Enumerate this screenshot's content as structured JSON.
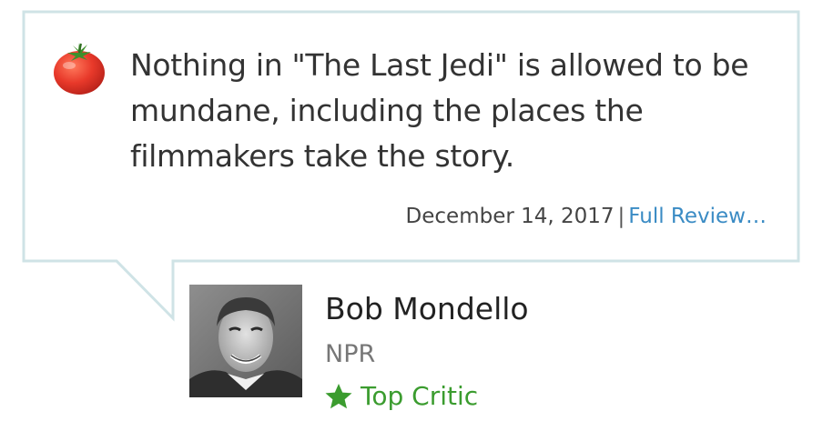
{
  "review": {
    "quote": "Nothing in \"The Last Jedi\" is allowed to be mundane, including the places the filmmakers take the story.",
    "date": "December 14, 2017",
    "separator": "|",
    "full_review_link": "Full Review…",
    "rating_icon": "fresh-tomato-icon"
  },
  "critic": {
    "name": "Bob Mondello",
    "outlet": "NPR",
    "badge_label": "Top Critic",
    "badge_icon": "star-icon"
  },
  "colors": {
    "bubble_border": "#cfe3e6",
    "link": "#3a8bc4",
    "top_critic": "#3b9c2f",
    "tomato": "#e8392a"
  }
}
